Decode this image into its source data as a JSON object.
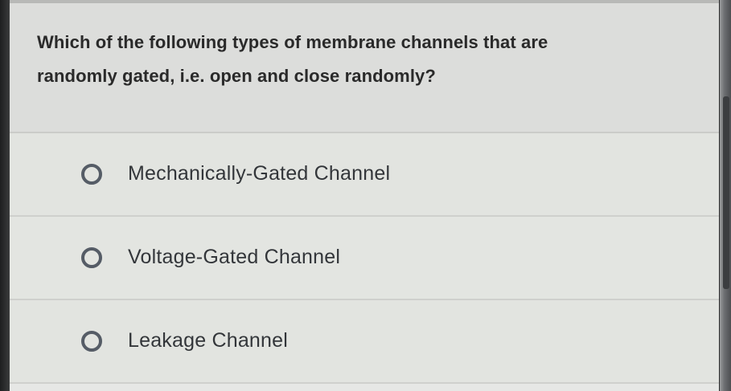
{
  "question": {
    "line1": "Which of the following types of membrane channels that are",
    "line2": "randomly gated, i.e. open and close randomly?"
  },
  "options": [
    {
      "label": "Mechanically-Gated Channel",
      "selected": false
    },
    {
      "label": "Voltage-Gated Channel",
      "selected": false
    },
    {
      "label": "Leakage Channel",
      "selected": false
    }
  ],
  "colors": {
    "question_background": "#dcdddb",
    "option_background": "#e2e4e0",
    "radio_border": "#555c66",
    "text": "#2a2a2a"
  },
  "icons": [
    "radio-button-unselected"
  ]
}
